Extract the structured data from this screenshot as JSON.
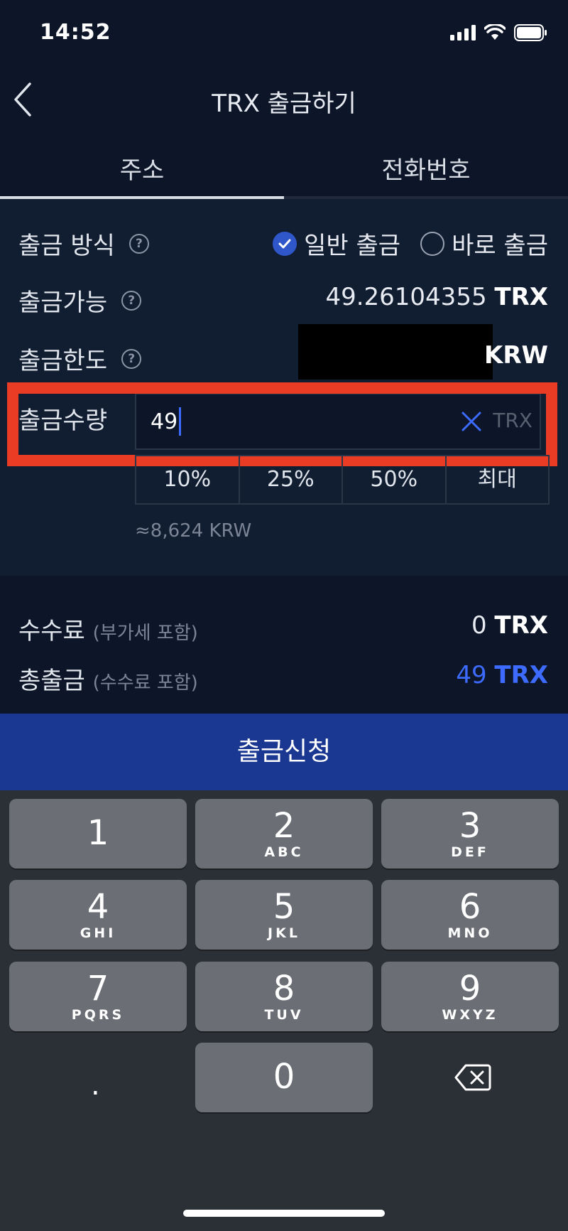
{
  "status_bar": {
    "time": "14:52"
  },
  "nav": {
    "title": "TRX 출금하기"
  },
  "tabs": [
    {
      "label": "주소",
      "active": true
    },
    {
      "label": "전화번호",
      "active": false
    }
  ],
  "form": {
    "method": {
      "label": "출금 방식",
      "options": [
        {
          "label": "일반 출금",
          "checked": true
        },
        {
          "label": "바로 출금",
          "checked": false
        }
      ]
    },
    "available": {
      "label": "출금가능",
      "value": "49.26104355",
      "unit": "TRX"
    },
    "limit": {
      "label": "출금한도",
      "unit": "KRW"
    },
    "amount": {
      "label": "출금수량",
      "value": "49",
      "unit": "TRX",
      "percent_buttons": [
        "10%",
        "25%",
        "50%",
        "최대"
      ],
      "krw_estimate": "≈8,624 KRW"
    }
  },
  "fees": {
    "fee": {
      "label": "수수료",
      "note": "(부가세 포함)",
      "value": "0",
      "unit": "TRX"
    },
    "total": {
      "label": "총출금",
      "note": "(수수료 포함)",
      "value": "49",
      "unit": "TRX"
    }
  },
  "submit_label": "출금신청",
  "keypad": {
    "keys": [
      {
        "num": "1",
        "letters": ""
      },
      {
        "num": "2",
        "letters": "ABC"
      },
      {
        "num": "3",
        "letters": "DEF"
      },
      {
        "num": "4",
        "letters": "GHI"
      },
      {
        "num": "5",
        "letters": "JKL"
      },
      {
        "num": "6",
        "letters": "MNO"
      },
      {
        "num": "7",
        "letters": "PQRS"
      },
      {
        "num": "8",
        "letters": "TUV"
      },
      {
        "num": "9",
        "letters": "WXYZ"
      },
      {
        "num": "0",
        "letters": ""
      }
    ],
    "dot": "."
  },
  "colors": {
    "background": "#0c1628",
    "accent_blue": "#3d6bff",
    "submit_bg": "#1a3791",
    "highlight_red": "#ea3b25"
  },
  "icons": [
    "back-chevron-icon",
    "help-icon",
    "check-icon",
    "clear-icon",
    "backspace-icon",
    "signal-icon",
    "wifi-icon",
    "battery-icon"
  ]
}
